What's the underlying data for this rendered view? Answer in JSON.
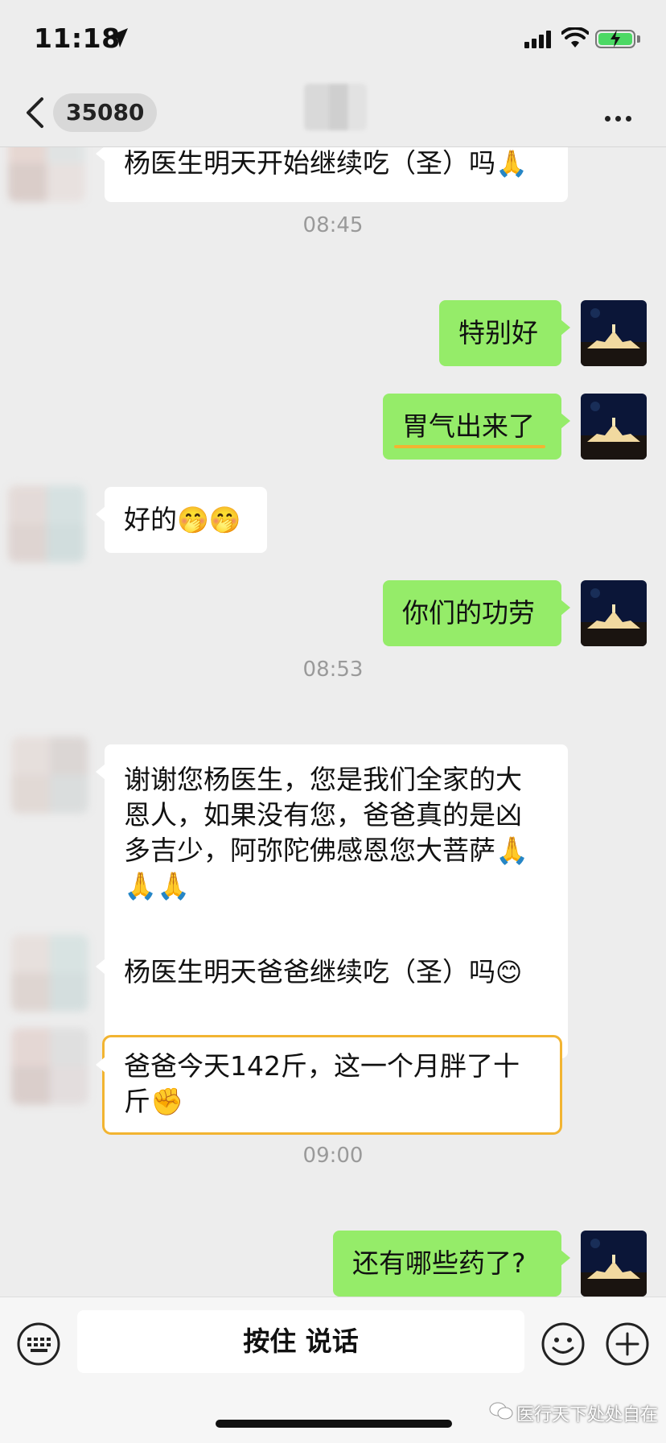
{
  "status_bar": {
    "time": "11:18",
    "icons": [
      "location-arrow-icon",
      "signal-icon",
      "wifi-icon",
      "battery-charging-icon"
    ]
  },
  "header": {
    "unread_count": "35080",
    "icons": [
      "back-chevron-icon",
      "more-icon"
    ]
  },
  "messages": [
    {
      "side": "left",
      "text": "杨医生明天开始继续吃（圣）吗",
      "emoji": "🙏"
    },
    {
      "type": "time",
      "text": "08:45"
    },
    {
      "side": "right",
      "text": "特别好"
    },
    {
      "side": "right",
      "text": "胃气出来了",
      "underlined": true
    },
    {
      "side": "left",
      "text": "好的",
      "emoji": "🤭🤭"
    },
    {
      "side": "right",
      "text": "你们的功劳"
    },
    {
      "type": "time",
      "text": "08:53"
    },
    {
      "side": "left",
      "lines": [
        "谢谢您杨医生，您是我们全家的大",
        "恩人，如果没有您，爸爸真的是凶",
        "多吉少，阿弥陀佛感恩您大菩萨🙏",
        "🙏🙏"
      ]
    },
    {
      "side": "left",
      "text": "杨医生明天爸爸继续吃（圣）吗",
      "emoji": "😊"
    },
    {
      "side": "left",
      "lines": [
        "爸爸今天142斤，这一个月胖了十",
        "斤✊"
      ],
      "highlighted": true
    },
    {
      "type": "time",
      "text": "09:00"
    },
    {
      "side": "right",
      "text": "还有哪些药了?"
    }
  ],
  "input_bar": {
    "voice_label": "按住 说话",
    "icons": [
      "keyboard-icon",
      "emoji-icon",
      "plus-icon"
    ]
  },
  "watermark": "医行天下处处自在",
  "colors": {
    "background": "#ededed",
    "outgoing_bubble": "#95ec69",
    "incoming_bubble": "#ffffff",
    "highlight": "#f2b431"
  }
}
